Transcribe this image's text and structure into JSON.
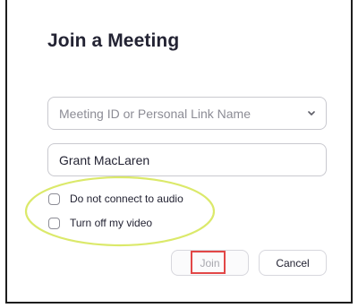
{
  "dialog": {
    "title": "Join a Meeting",
    "meeting_id_placeholder": "Meeting ID or Personal Link Name",
    "name_value": "Grant MacLaren",
    "options": [
      {
        "label": "Do not connect to audio",
        "checked": false
      },
      {
        "label": "Turn off my video",
        "checked": false
      }
    ],
    "join_label": "Join",
    "cancel_label": "Cancel"
  },
  "colors": {
    "title_text": "#232333",
    "placeholder_text": "#8c8c95",
    "input_border": "#c9c9cf",
    "annotation_ellipse": "#dbe96a",
    "annotation_box": "#e24747"
  },
  "icons": {
    "dropdown": "chevron-down-icon"
  }
}
